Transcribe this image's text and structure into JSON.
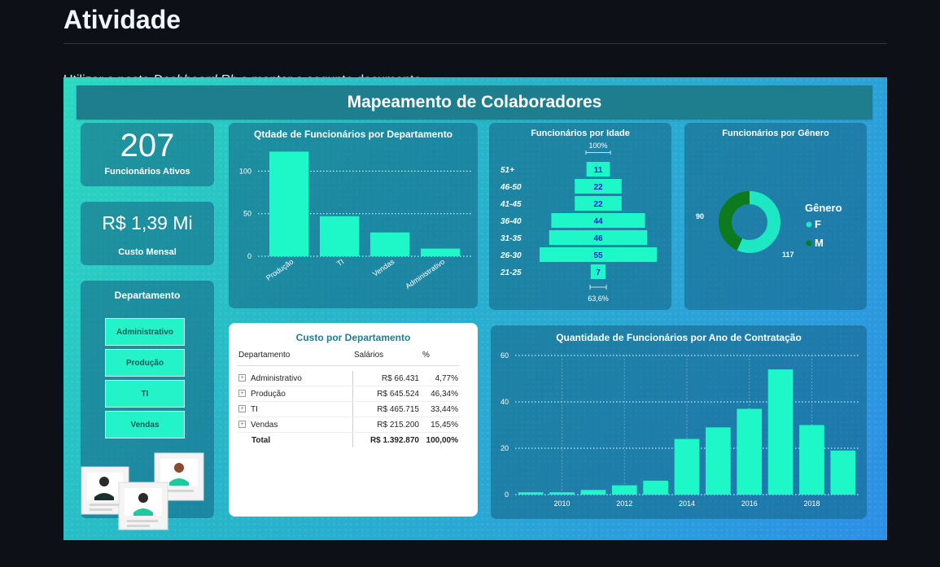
{
  "page": {
    "title": "Atividade",
    "intro_prefix": "Utilizar a pasta ",
    "intro_em": "Dashboard Rh",
    "intro_suffix": " e montar a segunte documento"
  },
  "dashboard": {
    "banner": "Mapeamento de Colaboradores",
    "kpi_employees": {
      "value": "207",
      "label": "Funcionários Ativos"
    },
    "kpi_cost": {
      "value": "R$ 1,39 Mi",
      "label": "Custo Mensal"
    },
    "slicer": {
      "title": "Departamento",
      "items": [
        "Administrativo",
        "Produção",
        "TI",
        "Vendas"
      ]
    },
    "cost_table": {
      "title": "Custo por Departamento",
      "columns": [
        "Departamento",
        "Salários",
        "%"
      ],
      "rows": [
        {
          "dept": "Administrativo",
          "salary": "R$ 66.431",
          "pct": "4,77%"
        },
        {
          "dept": "Produção",
          "salary": "R$ 645.524",
          "pct": "46,34%"
        },
        {
          "dept": "TI",
          "salary": "R$ 465.715",
          "pct": "33,44%"
        },
        {
          "dept": "Vendas",
          "salary": "R$ 215.200",
          "pct": "15,45%"
        }
      ],
      "total": {
        "label": "Total",
        "salary": "R$ 1.392.870",
        "pct": "100,00%"
      }
    }
  },
  "colors": {
    "bar": "#1ef7c8",
    "female": "#1ee8c3",
    "male": "#0d7a1e",
    "banner": "#1f7e8e",
    "age_label": "#2222cc"
  },
  "chart_data": [
    {
      "type": "bar",
      "title": "Qtdade de Funcionários por Departamento",
      "categories": [
        "Produção",
        "TI",
        "Vendas",
        "Administrativo"
      ],
      "values": [
        123,
        47,
        28,
        9
      ],
      "yticks": [
        0,
        50,
        100
      ],
      "ylim": [
        0,
        130
      ],
      "grid": true
    },
    {
      "type": "bar",
      "orientation": "horizontal",
      "title": "Funcionários por Idade",
      "categories": [
        "51+",
        "46-50",
        "41-45",
        "36-40",
        "31-35",
        "26-30",
        "21-25"
      ],
      "values": [
        11,
        22,
        22,
        44,
        46,
        55,
        7
      ],
      "top_annotation": "100%",
      "bottom_annotation": "63,6%"
    },
    {
      "type": "pie",
      "subtype": "donut",
      "title": "Funcionários por Gênero",
      "legend_title": "Gênero",
      "legend_position": "right",
      "series": [
        {
          "name": "F",
          "value": 117
        },
        {
          "name": "M",
          "value": 90
        }
      ]
    },
    {
      "type": "bar",
      "title": "Quantidade de Funcionários por Ano de Contratação",
      "x": [
        2009,
        2010,
        2011,
        2012,
        2013,
        2014,
        2015,
        2016,
        2017,
        2018,
        2019
      ],
      "values": [
        1,
        1,
        2,
        4,
        6,
        24,
        29,
        37,
        54,
        30,
        19
      ],
      "xticks": [
        2010,
        2012,
        2014,
        2016,
        2018
      ],
      "yticks": [
        0,
        20,
        40,
        60
      ],
      "ylim": [
        0,
        60
      ],
      "grid": true
    }
  ]
}
